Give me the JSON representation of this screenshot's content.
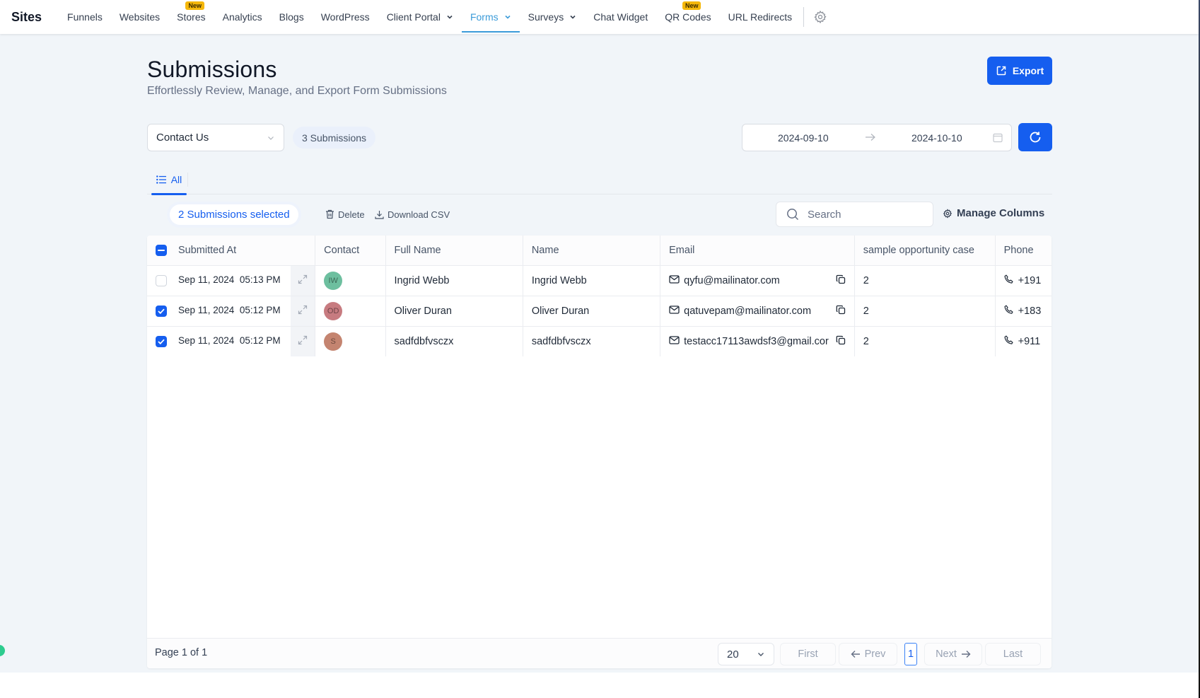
{
  "nav": {
    "brand": "Sites",
    "items": [
      {
        "label": "Funnels"
      },
      {
        "label": "Websites"
      },
      {
        "label": "Stores",
        "badge": "New"
      },
      {
        "label": "Analytics"
      },
      {
        "label": "Blogs"
      },
      {
        "label": "WordPress"
      },
      {
        "label": "Client Portal",
        "dropdown": true
      },
      {
        "label": "Forms",
        "dropdown": true,
        "active": true
      },
      {
        "label": "Surveys",
        "dropdown": true
      },
      {
        "label": "Chat Widget"
      },
      {
        "label": "QR Codes",
        "badge": "New"
      },
      {
        "label": "URL Redirects"
      }
    ],
    "settings_icon": "gear-icon"
  },
  "header": {
    "title": "Submissions",
    "subtitle": "Effortlessly Review, Manage, and Export Form Submissions",
    "export_label": "Export"
  },
  "filters": {
    "form_select": "Contact Us",
    "submission_count": "3 Submissions",
    "date_start": "2024-09-10",
    "date_end": "2024-10-10"
  },
  "tabs": [
    {
      "label": "All",
      "active": true
    }
  ],
  "toolbar": {
    "selected_label": "2 Submissions selected",
    "delete_label": "Delete",
    "download_label": "Download CSV",
    "search_placeholder": "Search",
    "manage_columns_label": "Manage Columns"
  },
  "table": {
    "columns": [
      "Submitted At",
      "Contact",
      "Full Name",
      "Name",
      "Email",
      "sample opportunity case",
      "Phone"
    ],
    "header_checkbox": "indeterminate",
    "rows": [
      {
        "checked": false,
        "submitted_at": "Sep 11, 2024  05:13 PM",
        "initials": "IW",
        "avatar_color": "#6dbf9f",
        "full_name": "Ingrid Webb",
        "name": "Ingrid Webb",
        "email": "qyfu@mailinator.com",
        "opportunity": "2",
        "phone": "+191"
      },
      {
        "checked": true,
        "submitted_at": "Sep 11, 2024  05:12 PM",
        "initials": "OD",
        "avatar_color": "#c77b80",
        "full_name": "Oliver Duran",
        "name": "Oliver Duran",
        "email": "qatuvepam@mailinator.com",
        "opportunity": "2",
        "phone": "+183"
      },
      {
        "checked": true,
        "submitted_at": "Sep 11, 2024  05:12 PM",
        "initials": "S",
        "avatar_color": "#c48470",
        "full_name": "sadfdbfvsczx",
        "name": "sadfdbfvsczx",
        "email": "testacc17113awdsf3@gmail.cor",
        "opportunity": "2",
        "phone": "+911"
      }
    ]
  },
  "pagination": {
    "page_info": "Page 1 of 1",
    "per_page": "20",
    "first": "First",
    "prev": "Prev",
    "current": "1",
    "next": "Next",
    "last": "Last"
  },
  "colors": {
    "primary": "#155eef",
    "nav_active": "#3b9bd9",
    "badge": "#f5b70a",
    "page_bg": "#f1f5f9"
  }
}
